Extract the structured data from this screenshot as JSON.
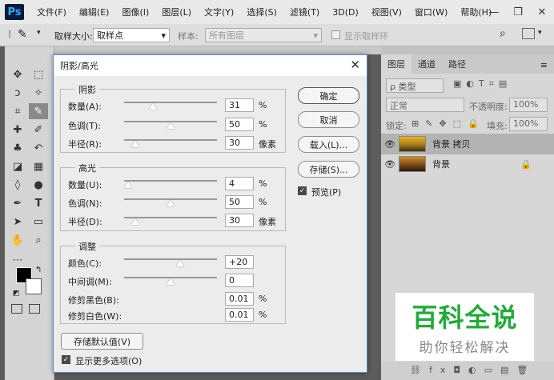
{
  "app": {
    "logo": "Ps"
  },
  "menu": [
    "文件(F)",
    "编辑(E)",
    "图像(I)",
    "图层(L)",
    "文字(Y)",
    "选择(S)",
    "滤镜(T)",
    "3D(D)",
    "视图(V)",
    "窗口(W)",
    "帮助(H)"
  ],
  "window_buttons": {
    "minimize": "—",
    "restore": "❐",
    "close": "✕"
  },
  "options_bar": {
    "sample_size_label": "取样大小:",
    "sample_size_value": "取样点",
    "sample_label": "样本:",
    "sample_value": "所有图层",
    "show_ring_label": "显示取样环"
  },
  "panel": {
    "tabs": [
      "图层",
      "通道",
      "路径"
    ],
    "kind_label": "ρ 类型",
    "blend_mode": "正常",
    "opacity_label": "不透明度:",
    "opacity_value": "100%",
    "lock_label": "锁定:",
    "fill_label": "填充:",
    "fill_value": "100%",
    "layers": [
      {
        "name": "背景 拷贝",
        "selected": true
      },
      {
        "name": "背景",
        "selected": false
      }
    ]
  },
  "dialog": {
    "title": "阴影/高光",
    "close": "✕",
    "shadows": {
      "legend": "阴影",
      "amount": {
        "label": "数量(A):",
        "value": "31",
        "unit": "%",
        "level": 0.31
      },
      "tone": {
        "label": "色调(T):",
        "value": "50",
        "unit": "%",
        "level": 0.5
      },
      "radius": {
        "label": "半径(R):",
        "value": "30",
        "unit": "像素",
        "level": 0.12
      }
    },
    "highlights": {
      "legend": "高光",
      "amount": {
        "label": "数量(U):",
        "value": "4",
        "unit": "%",
        "level": 0.04
      },
      "tone": {
        "label": "色调(N):",
        "value": "50",
        "unit": "%",
        "level": 0.5
      },
      "radius": {
        "label": "半径(D):",
        "value": "30",
        "unit": "像素",
        "level": 0.12
      }
    },
    "adjustments": {
      "legend": "调整",
      "color": {
        "label": "颜色(C):",
        "value": "+20",
        "level": 0.6
      },
      "midtone": {
        "label": "中间调(M):",
        "value": "0",
        "level": 0.5
      },
      "clip_black": {
        "label": "修剪黑色(B):",
        "value": "0.01",
        "unit": "%"
      },
      "clip_white": {
        "label": "修剪白色(W):",
        "value": "0.01",
        "unit": "%"
      }
    },
    "buttons": {
      "ok": "确定",
      "cancel": "取消",
      "load": "载入(L)...",
      "save": "存储(S)...",
      "preview": "预览(P)",
      "save_defaults": "存储默认值(V)",
      "more_options": "显示更多选项(O)"
    }
  },
  "watermark": {
    "title": "百科全说",
    "subtitle": "助你轻松解决"
  },
  "colors": {
    "accent_green": "#22aa3a",
    "dialog_border": "#5b87c9"
  }
}
